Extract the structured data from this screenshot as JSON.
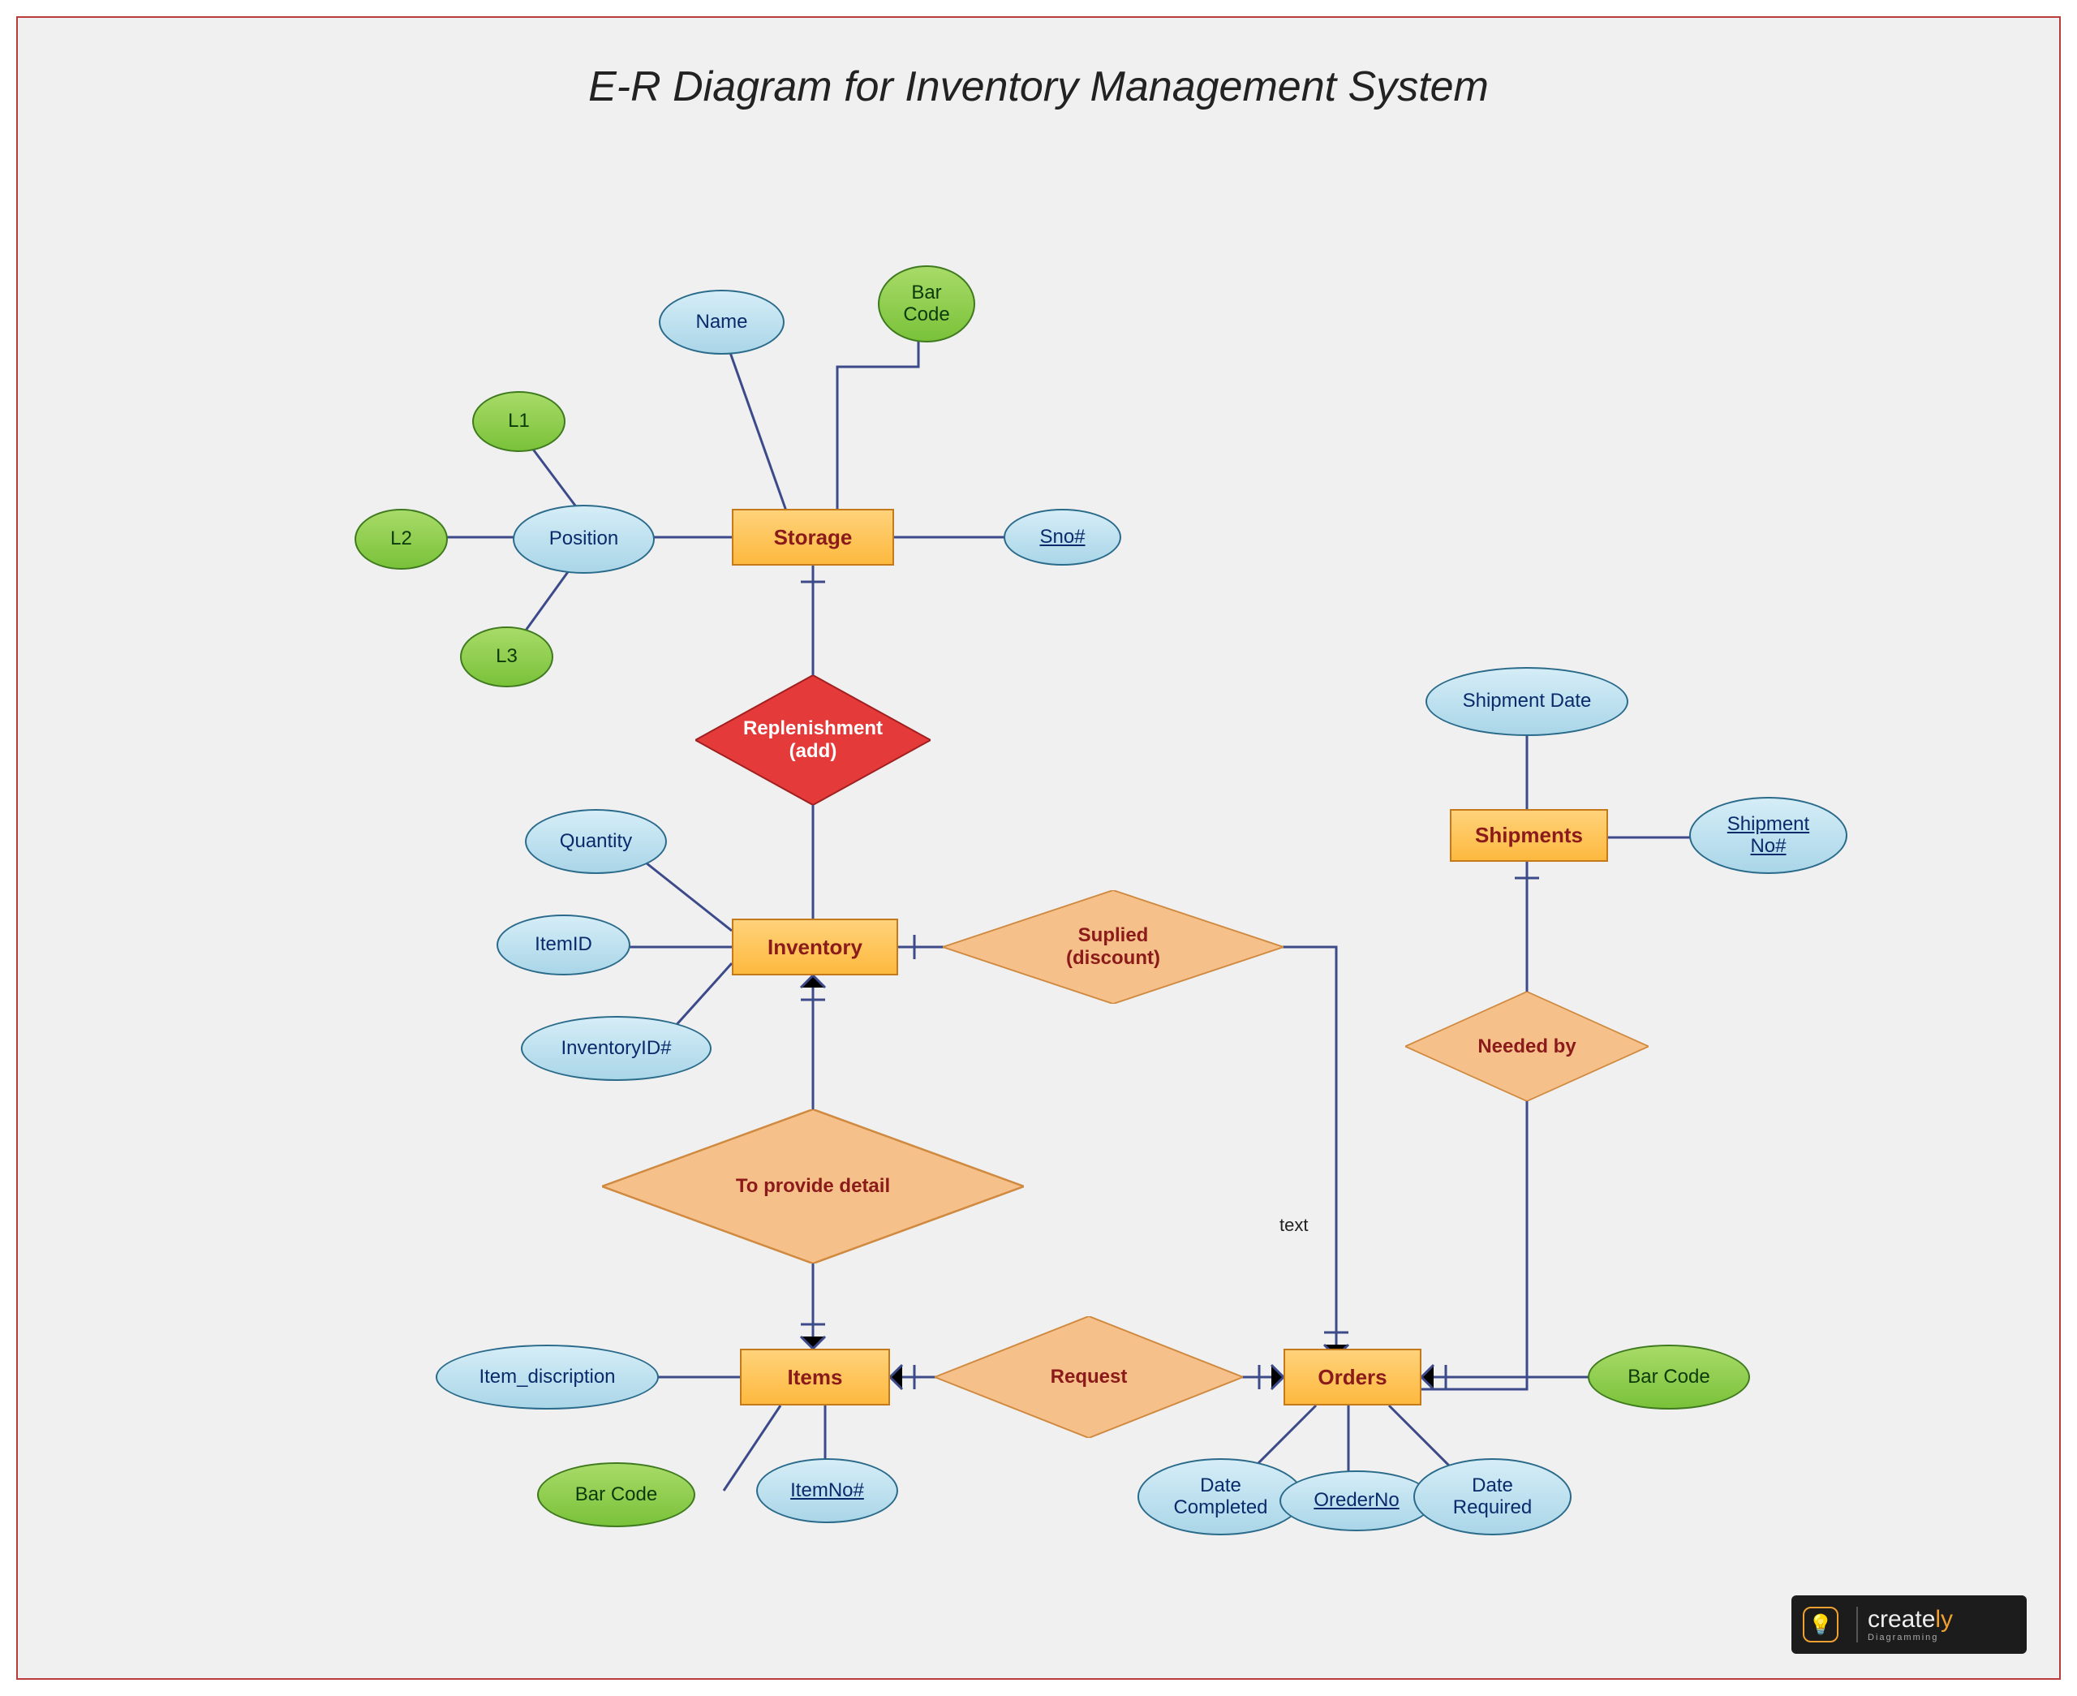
{
  "title": "E-R Diagram for Inventory Management System",
  "entities": {
    "storage": "Storage",
    "inventory": "Inventory",
    "items": "Items",
    "orders": "Orders",
    "shipments": "Shipments"
  },
  "relationships": {
    "replenishment": "Replenishment\n(add)",
    "supplied": "Suplied\n(discount)",
    "to_provide_detail": "To provide detail",
    "request": "Request",
    "needed_by": "Needed by"
  },
  "attributes": {
    "name": "Name",
    "bar_code_storage": "Bar\nCode",
    "sno": "Sno#",
    "position": "Position",
    "l1": "L1",
    "l2": "L2",
    "l3": "L3",
    "quantity": "Quantity",
    "item_id": "ItemID",
    "inventory_id": "InventoryID#",
    "item_description": "Item_discription",
    "item_no": "ItemNo#",
    "bar_code_items": "Bar Code",
    "date_completed": "Date\nCompleted",
    "order_no": "OrederNo",
    "date_required": "Date\nRequired",
    "bar_code_orders": "Bar Code",
    "shipment_date": "Shipment Date",
    "shipment_no": "Shipment\nNo#"
  },
  "labels": {
    "edge_text": "text"
  },
  "brand": {
    "name": "create",
    "suffix": "ly",
    "subtitle": "Diagramming"
  },
  "colors": {
    "entity_fill": "#fdb93f",
    "attr_blue": "#aad6e8",
    "attr_green": "#7ac23a",
    "rel_orange": "#f6c08a",
    "rel_red": "#e53a3a",
    "line": "#3c4a8a"
  }
}
